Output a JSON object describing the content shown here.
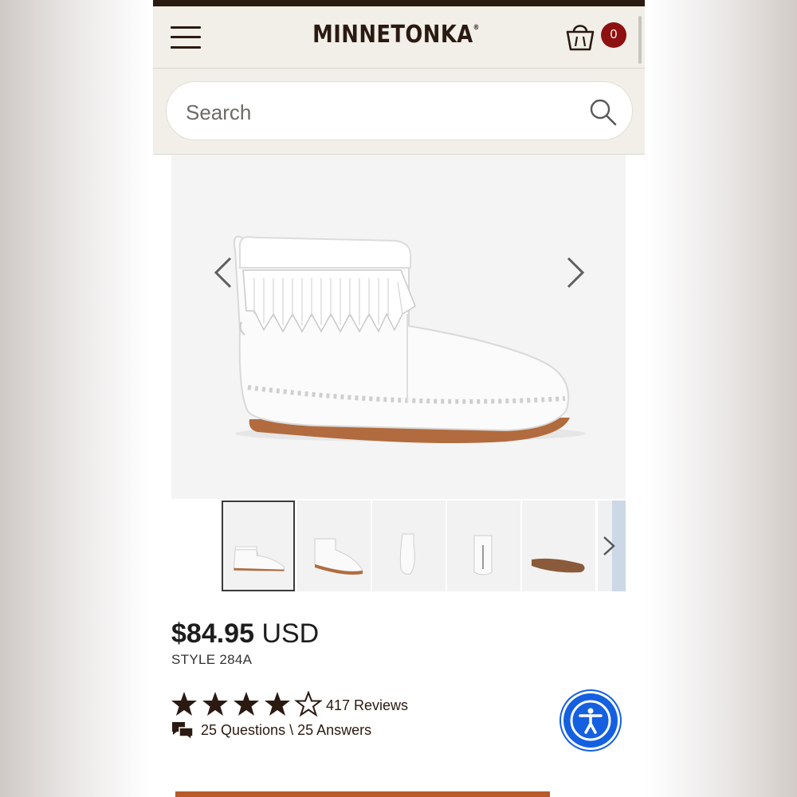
{
  "header": {
    "brand": "MINNETONKA",
    "brand_mark": "®",
    "cart_count": "0"
  },
  "search": {
    "placeholder": "Search"
  },
  "gallery": {
    "thumbnails": [
      "side view",
      "angled view",
      "front view",
      "back view",
      "sole view",
      "lifestyle view"
    ]
  },
  "product": {
    "price": "$84.95",
    "currency": "USD",
    "style": "STYLE 284A",
    "rating": 4.5,
    "rating_max": 5,
    "reviews": "417 Reviews",
    "qa": "25 Questions \\ 25 Answers"
  },
  "colors": {
    "accent": "#8e1010",
    "brand": "#2b1a12",
    "accessibility": "#1560e0",
    "cta": "#b85a2a"
  }
}
